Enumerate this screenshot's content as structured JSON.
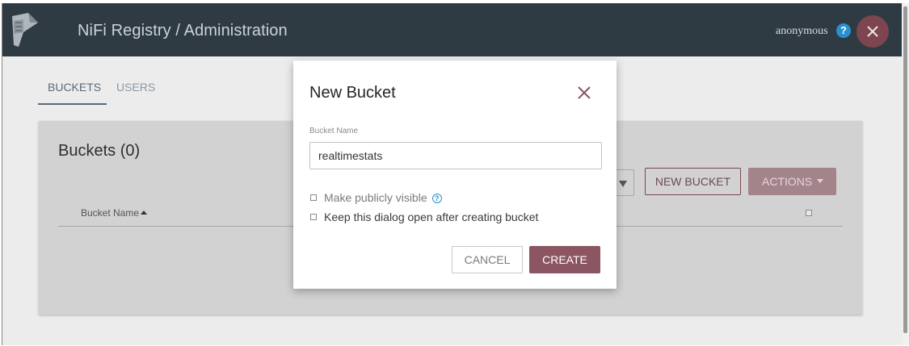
{
  "header": {
    "title": "NiFi Registry / Administration",
    "user": "anonymous",
    "help_icon": "?"
  },
  "tabs": [
    {
      "label": "BUCKETS",
      "active": true
    },
    {
      "label": "USERS",
      "active": false
    }
  ],
  "buckets_panel": {
    "title": "Buckets (0)",
    "new_bucket_label": "NEW BUCKET",
    "actions_label": "ACTIONS",
    "column_bucket_name": "Bucket Name"
  },
  "dialog": {
    "title": "New Bucket",
    "field_label": "Bucket Name",
    "field_value": "realtimestats",
    "public_label": "Make publicly visible",
    "info_icon": "?",
    "keep_open_label": "Keep this dialog open after creating bucket",
    "cancel_label": "CANCEL",
    "create_label": "CREATE"
  },
  "colors": {
    "topbar": "#2f3b43",
    "accent": "#8b5561",
    "help": "#2a8fd0"
  },
  "icons": [
    "nifi-registry-logo-icon",
    "help-icon",
    "close-icon",
    "filter-icon",
    "caret-down-icon",
    "sort-asc-icon",
    "info-icon"
  ]
}
